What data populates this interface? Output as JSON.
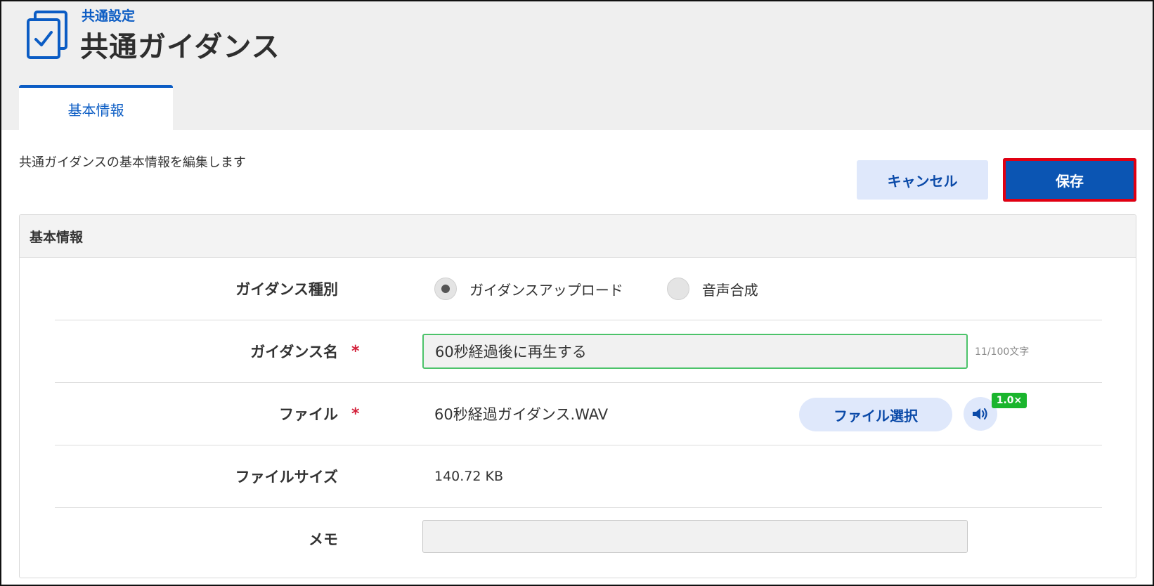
{
  "header": {
    "breadcrumb": "共通設定",
    "title": "共通ガイダンス",
    "icon": "checklist-icon",
    "tabs": [
      {
        "label": "基本情報",
        "active": true
      }
    ]
  },
  "description": "共通ガイダンスの基本情報を編集します",
  "actions": {
    "cancel_label": "キャンセル",
    "save_label": "保存"
  },
  "panel": {
    "title": "基本情報",
    "fields": {
      "guidance_type": {
        "label": "ガイダンス種別",
        "options": [
          {
            "label": "ガイダンスアップロード",
            "selected": true
          },
          {
            "label": "音声合成",
            "selected": false
          }
        ]
      },
      "guidance_name": {
        "label": "ガイダンス名",
        "required_mark": "*",
        "value": "60秒経過後に再生する",
        "counter": "11/100文字"
      },
      "file": {
        "label": "ファイル",
        "required_mark": "*",
        "filename": "60秒経過ガイダンス.WAV",
        "select_button": "ファイル選択",
        "play_icon": "speaker-icon",
        "speed": "1.0×"
      },
      "file_size": {
        "label": "ファイルサイズ",
        "value": "140.72 KB"
      },
      "memo": {
        "label": "メモ",
        "value": ""
      }
    }
  },
  "colors": {
    "accent": "#0b55b3",
    "highlight_border": "#e00012",
    "input_focus": "#4cc36a",
    "speed_badge": "#1ab52d",
    "required": "#d3203a"
  }
}
